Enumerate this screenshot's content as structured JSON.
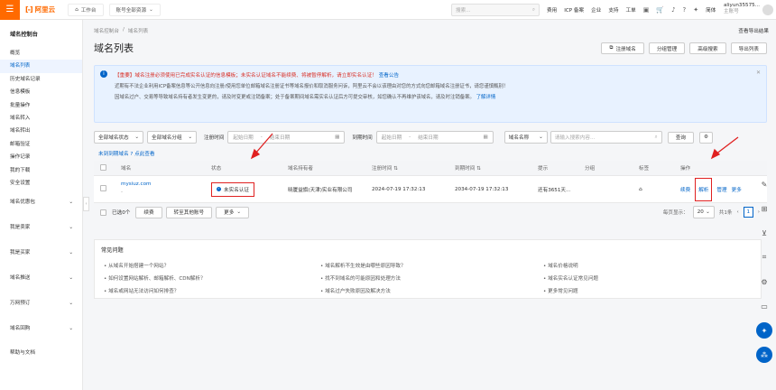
{
  "topbar": {
    "brand": "阿里云",
    "workbench": "工作台",
    "account_scope": "账号全部资源",
    "search_placeholder": "搜索...",
    "nav": [
      "费用",
      "ICP 备案",
      "企业",
      "支持",
      "工单"
    ],
    "lang": "简体",
    "user_name": "aliyun35575...",
    "user_sub": "主账号"
  },
  "sidebar": {
    "title": "域名控制台",
    "items": [
      "概览",
      "域名列表",
      "历史域名记录",
      "信息模板",
      "批量操作",
      "域名转入",
      "域名转出",
      "邮箱验证",
      "操作记录",
      "我的下载",
      "安全设置"
    ],
    "active_index": 1,
    "groups": [
      "域名优惠包",
      "我是卖家",
      "我是买家",
      "域名推送",
      "万网预订",
      "域名回购"
    ],
    "footer": "帮助与文档"
  },
  "breadcrumb": [
    "域名控制台",
    "域名列表"
  ],
  "page_title": "域名列表",
  "help_link": "查看导出结果",
  "actions": {
    "register": "注册域名",
    "group": "分组管理",
    "advanced": "高级搜索",
    "export": "导出列表"
  },
  "notice": {
    "important_prefix": "【重要】",
    "line1_red": "域名注册必须使用已完成实名认证的信息模板；未实名认证域名不能续费、将被暂停解析，请立即实名认证！",
    "line1_link": "查看公告",
    "line2": "近期有不法企业利用ICP备案信息等公开信息向注册/使用您单位邮箱域名注册证书等域名报价和取消服务问诉，阿里云不会以该理由对您的方式向您邮箱域名注册证书，请您谨慎甄别！",
    "line3": "因域名过户、交易等导致域名持有者发生变更的，请及时变更或注销备案；处于备案期间域名需实名认证后方可提交审核，如您确认不再维护该域名，请及时注销备案。",
    "line3_link": "了解详情"
  },
  "filters": {
    "status": "全部域名状态",
    "group": "全部域名分组",
    "reg_label": "注册时间",
    "start_placeholder": "起始日期",
    "end_placeholder": "结束日期",
    "exp_label": "到期时间",
    "name_select": "域名名称",
    "search_placeholder": "请输入搜索内容...",
    "search_btn": "查询"
  },
  "expired_link": "未到到期域名 ? 点此查看",
  "table": {
    "headers": [
      "域名",
      "状态",
      "域名持有者",
      "注册时间",
      "到期时间",
      "提示",
      "分组",
      "标签",
      "操作"
    ],
    "rows": [
      {
        "domain": "mysiuz.com",
        "status": "未实名认证",
        "holder": "晓厦益旗(天津)实业有限公司",
        "registered": "2024-07-19 17:32:13",
        "expires": "2034-07-19 17:32:13",
        "tip": "还有3651天...",
        "ops": [
          "续费",
          "解析",
          "管理",
          "更多"
        ]
      }
    ]
  },
  "bulk": {
    "selected": "已选0个",
    "renew": "续费",
    "transfer": "转至其他账号",
    "more": "更多",
    "page_size_label": "每页显示：",
    "page_size": "20",
    "total": "共1条",
    "page": "1"
  },
  "faq": {
    "title": "常见问题",
    "items": [
      "从域名开始搭建一个网站？",
      "域名解析不生效是由哪些原因导致？",
      "域名价格说明",
      "如何设置网站解析、邮箱解析、CDN解析？",
      "找不到域名的可能原因和处理方法",
      "域名实名认证常见问题",
      "域名或网站无法访问如何排查？",
      "域名过户失败原因及解决方法",
      "更多常见问题"
    ]
  },
  "colors": {
    "brand": "#ff6a00",
    "link": "#0064c8",
    "highlight": "#e02020"
  }
}
